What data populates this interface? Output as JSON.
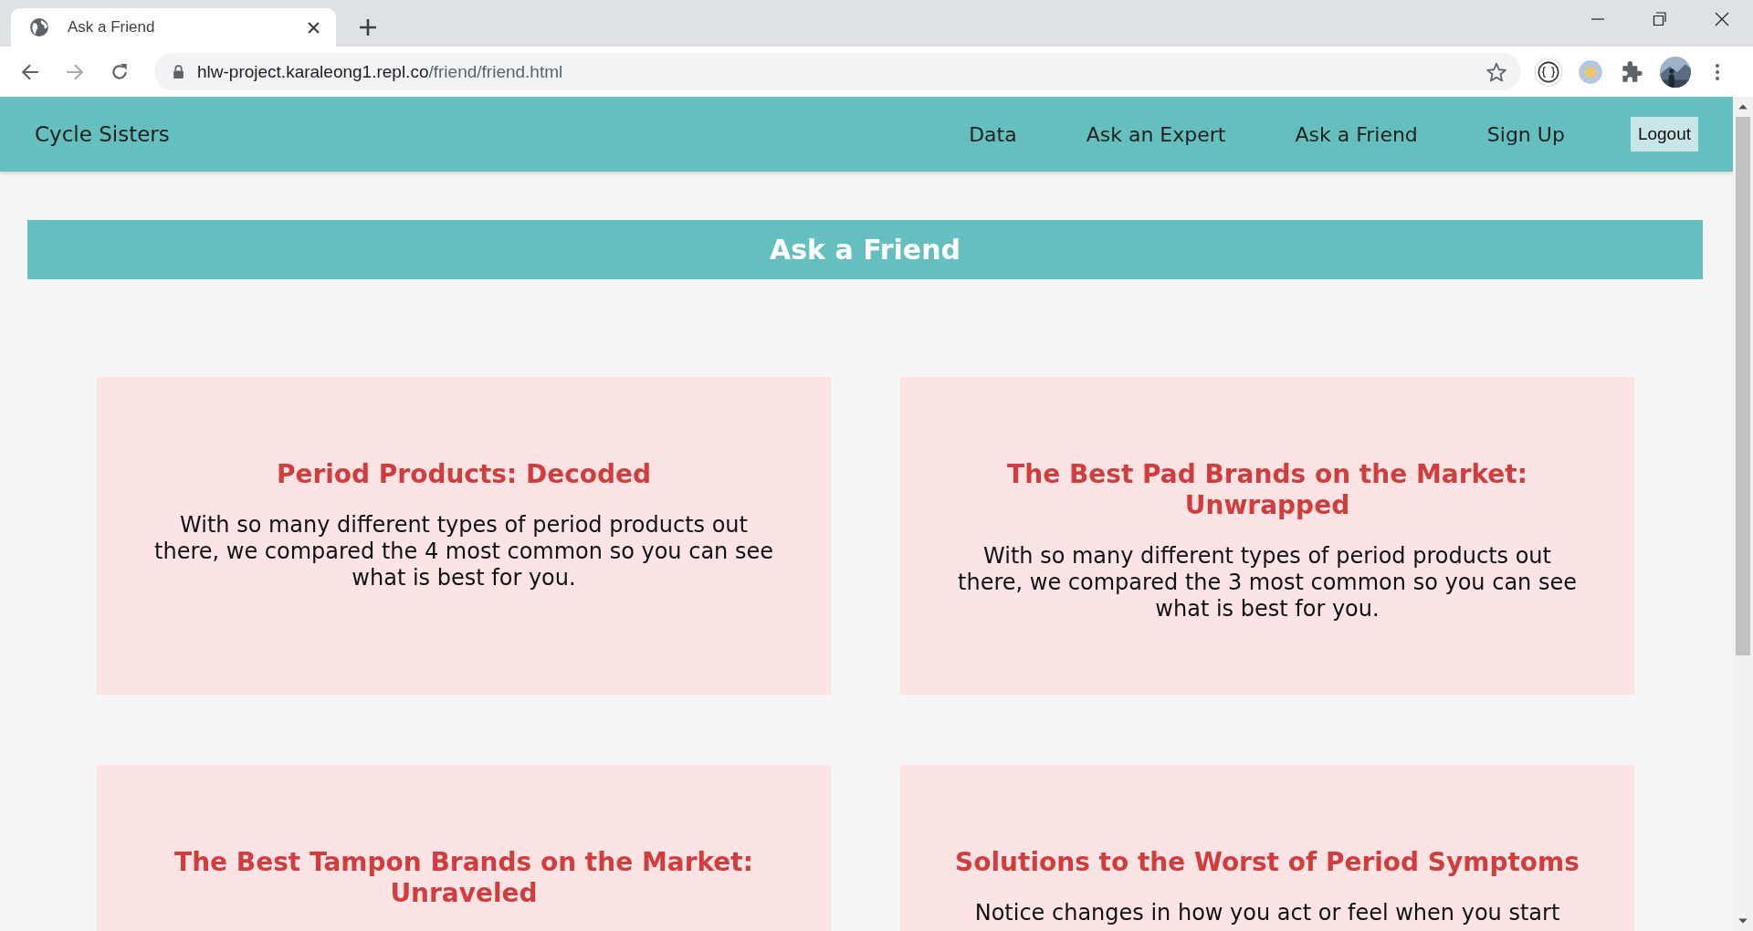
{
  "browser": {
    "tab": {
      "title": "Ask a Friend",
      "selected": true
    },
    "address": {
      "host": "hlw-project.karaleong1.repl.co",
      "path": "/friend/friend.html"
    }
  },
  "navbar": {
    "brand": "Cycle Sisters",
    "links": [
      {
        "label": "Data"
      },
      {
        "label": "Ask an Expert"
      },
      {
        "label": "Ask a Friend"
      },
      {
        "label": "Sign Up"
      }
    ],
    "button": "Logout"
  },
  "banner": {
    "title": "Ask a Friend"
  },
  "cards": [
    {
      "title": "Period Products: Decoded",
      "body": "With so many different types of period products out there, we compared the 4 most common so you can see what is best for you."
    },
    {
      "title": "The Best Pad Brands on the Market: Unwrapped",
      "body": "With so many different types of period products out there, we compared the 3 most common so you can see what is best for you."
    },
    {
      "title": "The Best Tampon Brands on the Market: Unraveled"
    },
    {
      "title": "Solutions to the Worst of Period Symptoms",
      "body": "Notice changes in how you act or feel when you start"
    }
  ]
}
